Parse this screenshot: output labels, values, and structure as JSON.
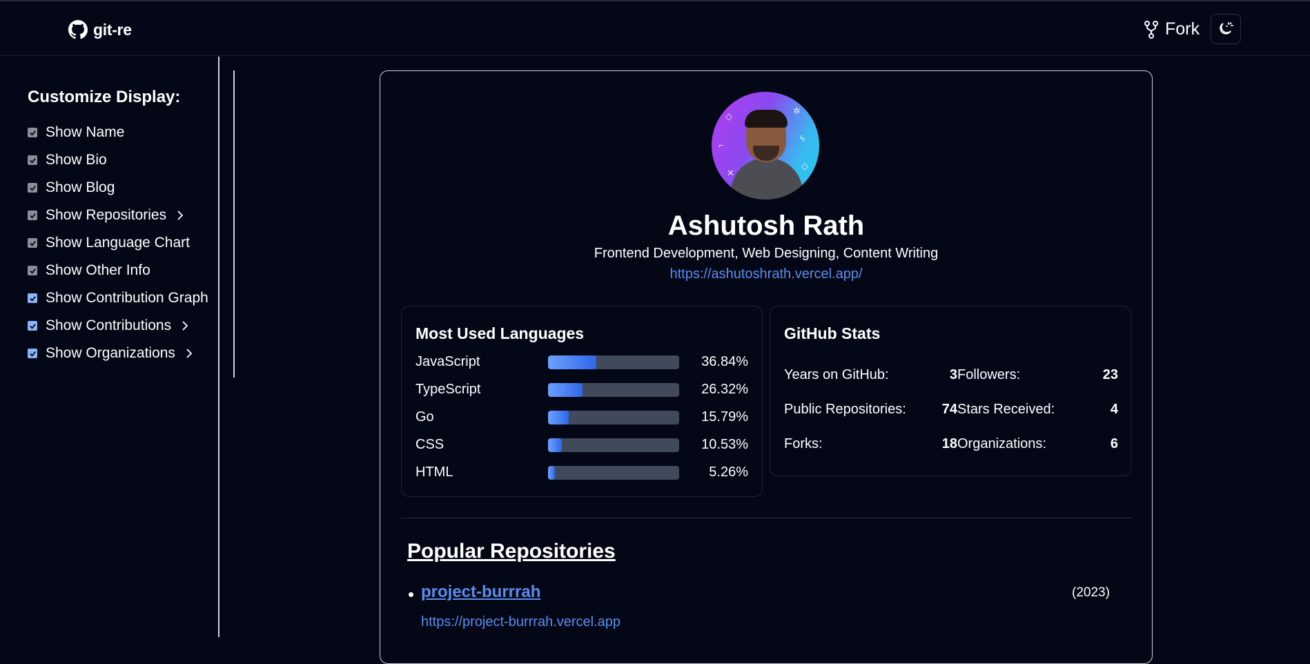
{
  "app": {
    "title": "git-re"
  },
  "header": {
    "fork_label": "Fork"
  },
  "sidebar": {
    "title": "Customize Display:",
    "options": [
      {
        "label": "Show Name",
        "checked": true,
        "style": "grey",
        "expandable": false
      },
      {
        "label": "Show Bio",
        "checked": true,
        "style": "grey",
        "expandable": false
      },
      {
        "label": "Show Blog",
        "checked": true,
        "style": "grey",
        "expandable": false
      },
      {
        "label": "Show Repositories",
        "checked": true,
        "style": "grey",
        "expandable": true
      },
      {
        "label": "Show Language Chart",
        "checked": true,
        "style": "grey",
        "expandable": false
      },
      {
        "label": "Show Other Info",
        "checked": true,
        "style": "grey",
        "expandable": false
      },
      {
        "label": "Show Contribution Graph",
        "checked": true,
        "style": "blue",
        "expandable": false
      },
      {
        "label": "Show Contributions",
        "checked": true,
        "style": "blue",
        "expandable": true
      },
      {
        "label": "Show Organizations",
        "checked": true,
        "style": "blue",
        "expandable": true
      }
    ]
  },
  "profile": {
    "name": "Ashutosh Rath",
    "bio": "Frontend Development, Web Designing, Content Writing",
    "blog": "https://ashutoshrath.vercel.app/"
  },
  "languages": {
    "title": "Most Used Languages",
    "items": [
      {
        "name": "JavaScript",
        "percent": "36.84%",
        "value": 36.84
      },
      {
        "name": "TypeScript",
        "percent": "26.32%",
        "value": 26.32
      },
      {
        "name": "Go",
        "percent": "15.79%",
        "value": 15.79
      },
      {
        "name": "CSS",
        "percent": "10.53%",
        "value": 10.53
      },
      {
        "name": "HTML",
        "percent": "5.26%",
        "value": 5.26
      }
    ]
  },
  "stats": {
    "title": "GitHub Stats",
    "items": [
      {
        "label": "Years on GitHub:",
        "value": "3"
      },
      {
        "label": "Followers:",
        "value": "23"
      },
      {
        "label": "Public Repositories:",
        "value": "74"
      },
      {
        "label": "Stars Received:",
        "value": "4"
      },
      {
        "label": "Forks:",
        "value": "18"
      },
      {
        "label": "Organizations:",
        "value": "6"
      }
    ]
  },
  "repositories": {
    "title": "Popular Repositories",
    "items": [
      {
        "name": "project-burrrah",
        "year": "(2023)",
        "url": "https://project-burrrah.vercel.app"
      }
    ]
  },
  "colors": {
    "background": "#040816",
    "accent": "#5b8def",
    "checkbox_active": "#8ab4f8"
  },
  "icons": {
    "brand": "github-icon",
    "fork": "fork-icon",
    "theme": "moon-sun-icon",
    "expand": "chevron-right-icon"
  }
}
